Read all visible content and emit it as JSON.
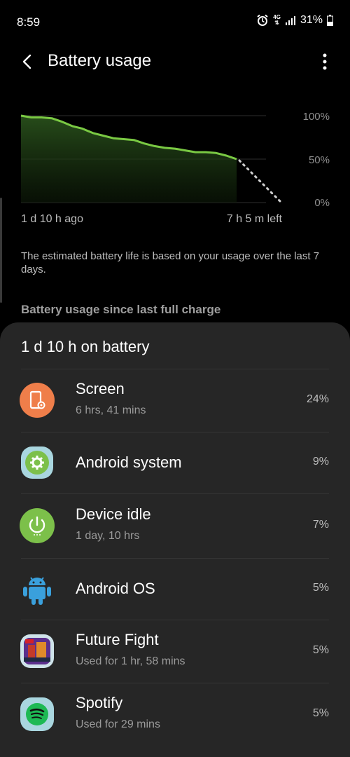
{
  "status_bar": {
    "time": "8:59",
    "network": "4G",
    "battery_percent": "31%"
  },
  "header": {
    "title": "Battery usage"
  },
  "chart_data": {
    "type": "line",
    "y_ticks": [
      "100%",
      "50%",
      "0%"
    ],
    "x_start_label": "1 d 10 h ago",
    "x_end_label": "7 h 5 m left",
    "ylim": [
      0,
      100
    ],
    "series": [
      {
        "values": [
          100,
          98,
          98,
          97,
          93,
          88,
          85,
          80,
          77,
          74,
          73,
          72,
          68,
          65,
          63,
          62,
          60,
          58,
          58,
          57,
          54,
          50
        ],
        "color": "#7ac943"
      }
    ],
    "projected": [
      50,
      0
    ],
    "grid": true
  },
  "estimate_note": "The estimated battery life is based on your usage over the last 7 days.",
  "section_heading": "Battery usage since last full charge",
  "usage": {
    "on_battery": "1 d 10 h on battery",
    "apps": [
      {
        "name": "Screen",
        "sub": "6 hrs, 41 mins",
        "percent": "24%",
        "icon": "screen-icon",
        "color": "#ef7e4a"
      },
      {
        "name": "Android system",
        "sub": "",
        "percent": "9%",
        "icon": "android-system-icon",
        "color": "#7cc04a"
      },
      {
        "name": "Device idle",
        "sub": "1 day, 10 hrs",
        "percent": "7%",
        "icon": "power-icon",
        "color": "#7cc04a"
      },
      {
        "name": "Android OS",
        "sub": "",
        "percent": "5%",
        "icon": "android-os-icon",
        "color": "#3aa0dc"
      },
      {
        "name": "Future Fight",
        "sub": "Used for 1 hr, 58 mins",
        "percent": "5%",
        "icon": "future-fight-icon",
        "color": "#5b2f8c"
      },
      {
        "name": "Spotify",
        "sub": "Used for 29 mins",
        "percent": "5%",
        "icon": "spotify-icon",
        "color": "#1db954"
      }
    ]
  }
}
